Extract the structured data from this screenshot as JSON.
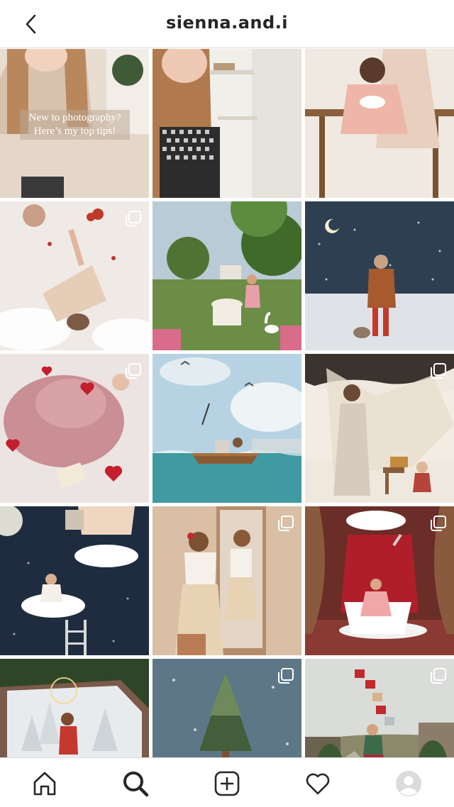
{
  "header": {
    "title": "sienna.and.i",
    "back_icon": "chevron-left-icon"
  },
  "grid": {
    "tiles": [
      {
        "caption": "New to photography? Here’s my top tips!",
        "multi": false
      },
      {
        "caption": "",
        "multi": false
      },
      {
        "caption": "",
        "multi": false
      },
      {
        "caption": "",
        "multi": true
      },
      {
        "caption": "",
        "multi": false
      },
      {
        "caption": "",
        "multi": false
      },
      {
        "caption": "",
        "multi": true
      },
      {
        "caption": "",
        "multi": false
      },
      {
        "caption": "",
        "multi": true
      },
      {
        "caption": "",
        "multi": false
      },
      {
        "caption": "",
        "multi": true
      },
      {
        "caption": "",
        "multi": true
      },
      {
        "caption": "",
        "multi": false
      },
      {
        "caption": "",
        "multi": true
      },
      {
        "caption": "",
        "multi": true
      }
    ]
  },
  "bottom_nav": {
    "items": [
      "home-icon",
      "search-icon",
      "new-post-icon",
      "activity-heart-icon",
      "profile-avatar"
    ],
    "active": "search-icon"
  }
}
